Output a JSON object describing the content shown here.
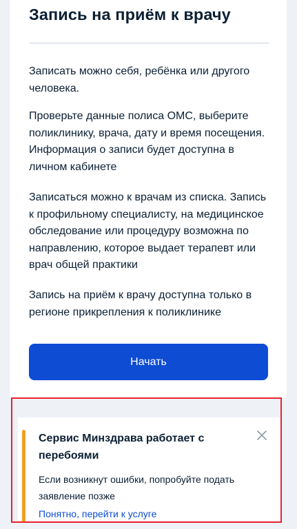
{
  "page": {
    "title": "Запись на приём к врачу",
    "paragraphs": [
      "Записать можно себя, ребёнка или другого человека.",
      "Проверьте данные полиса ОМС, выберите поликлинику, врача, дату и время посещения. Информация о записи будет доступна в личном кабинете",
      "Записаться можно к врачам из списка. Запись к профильному специалисту, на медицинское обследование или процедуру возможна по направлению, которое выдает терапевт или врач общей практики",
      "Запись на приём к врачу доступна только в регионе прикрепления к поликлинике"
    ],
    "start_button_label": "Начать"
  },
  "alert": {
    "title": "Сервис Минздрава работает с перебоями",
    "text": "Если возникнут ошибки, попробуйте подать заявление позже",
    "link_label": "Понятно, перейти к услуге",
    "close_icon": "close-icon"
  },
  "colors": {
    "primary": "#0d4cd3",
    "warning_bar": "#f0a020",
    "highlight_border": "#e8212c",
    "text": "#0b1f33",
    "background": "#eef2f7"
  }
}
